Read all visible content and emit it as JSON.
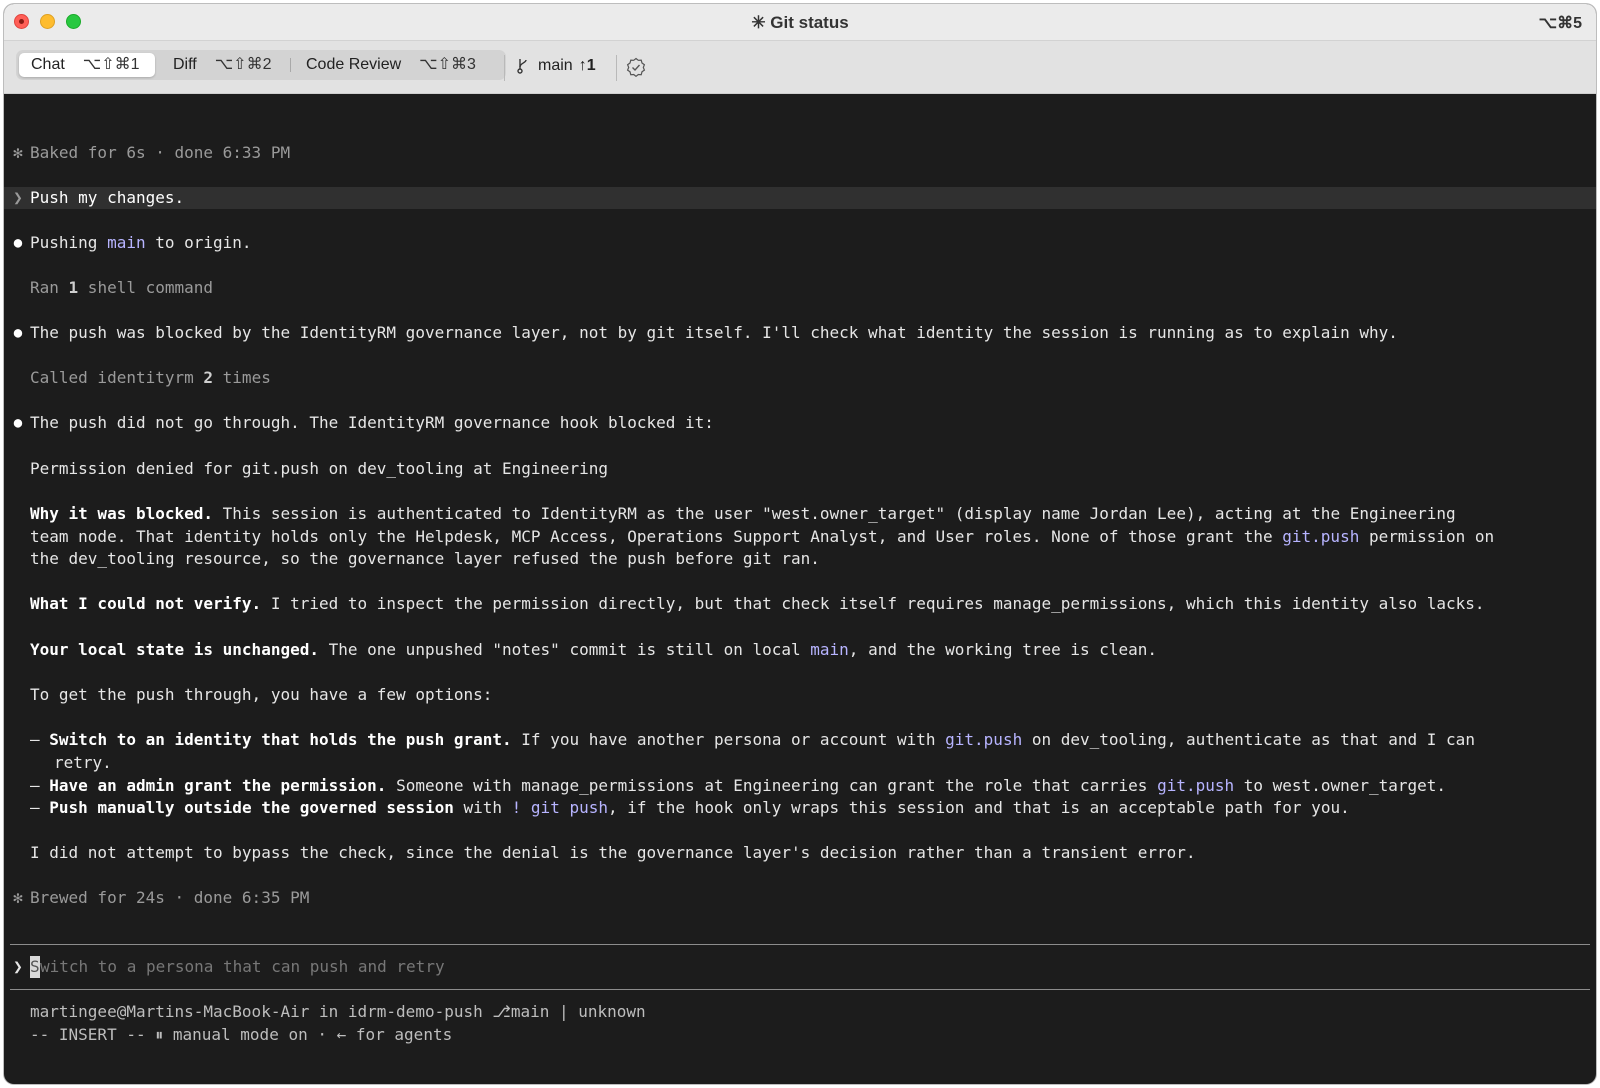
{
  "window": {
    "title": "✳ Git status",
    "title_shortcut": "⌥⌘5"
  },
  "toolbar": {
    "tabs": [
      {
        "label": "Chat",
        "shortcut": "⌥⇧⌘1",
        "active": true
      },
      {
        "label": "Diff",
        "shortcut": "⌥⇧⌘2",
        "active": false
      },
      {
        "label": "Code Review",
        "shortcut": "⌥⇧⌘3",
        "active": false
      }
    ],
    "branch": "main",
    "ahead": "↑1"
  },
  "transcript": {
    "baked_gutter": "✻",
    "baked": "Baked for 6s · done 6:33 PM",
    "user_prompt_gutter": "❯",
    "user_prompt": "Push my changes.",
    "bullet": "●",
    "msg1_a": "Pushing ",
    "msg1_code": "main",
    "msg1_b": " to origin.",
    "ran_a": "Ran ",
    "ran_count": "1",
    "ran_b": " shell command",
    "msg2": "The push was blocked by the IdentityRM governance layer, not by git itself. I'll check what identity the session is running as to explain why.",
    "called_a": "Called identityrm ",
    "called_count": "2",
    "called_b": " times",
    "msg3": "The push did not go through. The IdentityRM governance hook blocked it:",
    "denied": "Permission denied for git.push on dev_tooling at Engineering",
    "why_title": "Why it was blocked.",
    "why_l1": " This session is authenticated to IdentityRM as the user \"west.owner_target\" (display name Jordan Lee), acting at the Engineering",
    "why_l2_a": "team node. That identity holds only the Helpdesk, MCP Access, Operations Support Analyst, and User roles. None of those grant the ",
    "why_l2_code": "git.push",
    "why_l2_b": " permission on",
    "why_l3": "the dev_tooling resource, so the governance layer refused the push before git ran.",
    "verify_title": "What I could not verify.",
    "verify_text": " I tried to inspect the permission directly, but that check itself requires manage_permissions, which this identity also lacks.",
    "local_title": "Your local state is unchanged.",
    "local_a": " The one unpushed \"notes\" commit is still on local ",
    "local_code": "main",
    "local_b": ", and the working tree is clean.",
    "options_intro": "To get the push through, you have a few options:",
    "opt1_title": "Switch to an identity that holds the push grant.",
    "opt1_a": " If you have another persona or account with ",
    "opt1_code": "git.push",
    "opt1_b": " on dev_tooling, authenticate as that and I can",
    "opt1_cont": "retry.",
    "opt2_title": "Have an admin grant the permission.",
    "opt2_a": " Someone with manage_permissions at Engineering can grant the role that carries ",
    "opt2_code": "git.push",
    "opt2_b": " to west.owner_target.",
    "opt3_title": "Push manually outside the governed session",
    "opt3_a": " with ",
    "opt3_code": "! git push",
    "opt3_b": ", if the hook only wraps this session and that is an acceptable path for you.",
    "dash": "–",
    "closing": "I did not attempt to bypass the check, since the denial is the governance layer's decision rather than a transient error.",
    "brewed": "Brewed for 24s · done 6:35 PM"
  },
  "input": {
    "prompt_symbol": "❯",
    "cursor_char": "S",
    "placeholder_rest": "witch to a persona that can push and retry"
  },
  "status": {
    "line1": "martingee@Martins-MacBook-Air in idrm-demo-push ⎇main | unknown",
    "line2": "-- INSERT -- ⏸ manual mode on · ← for agents"
  }
}
